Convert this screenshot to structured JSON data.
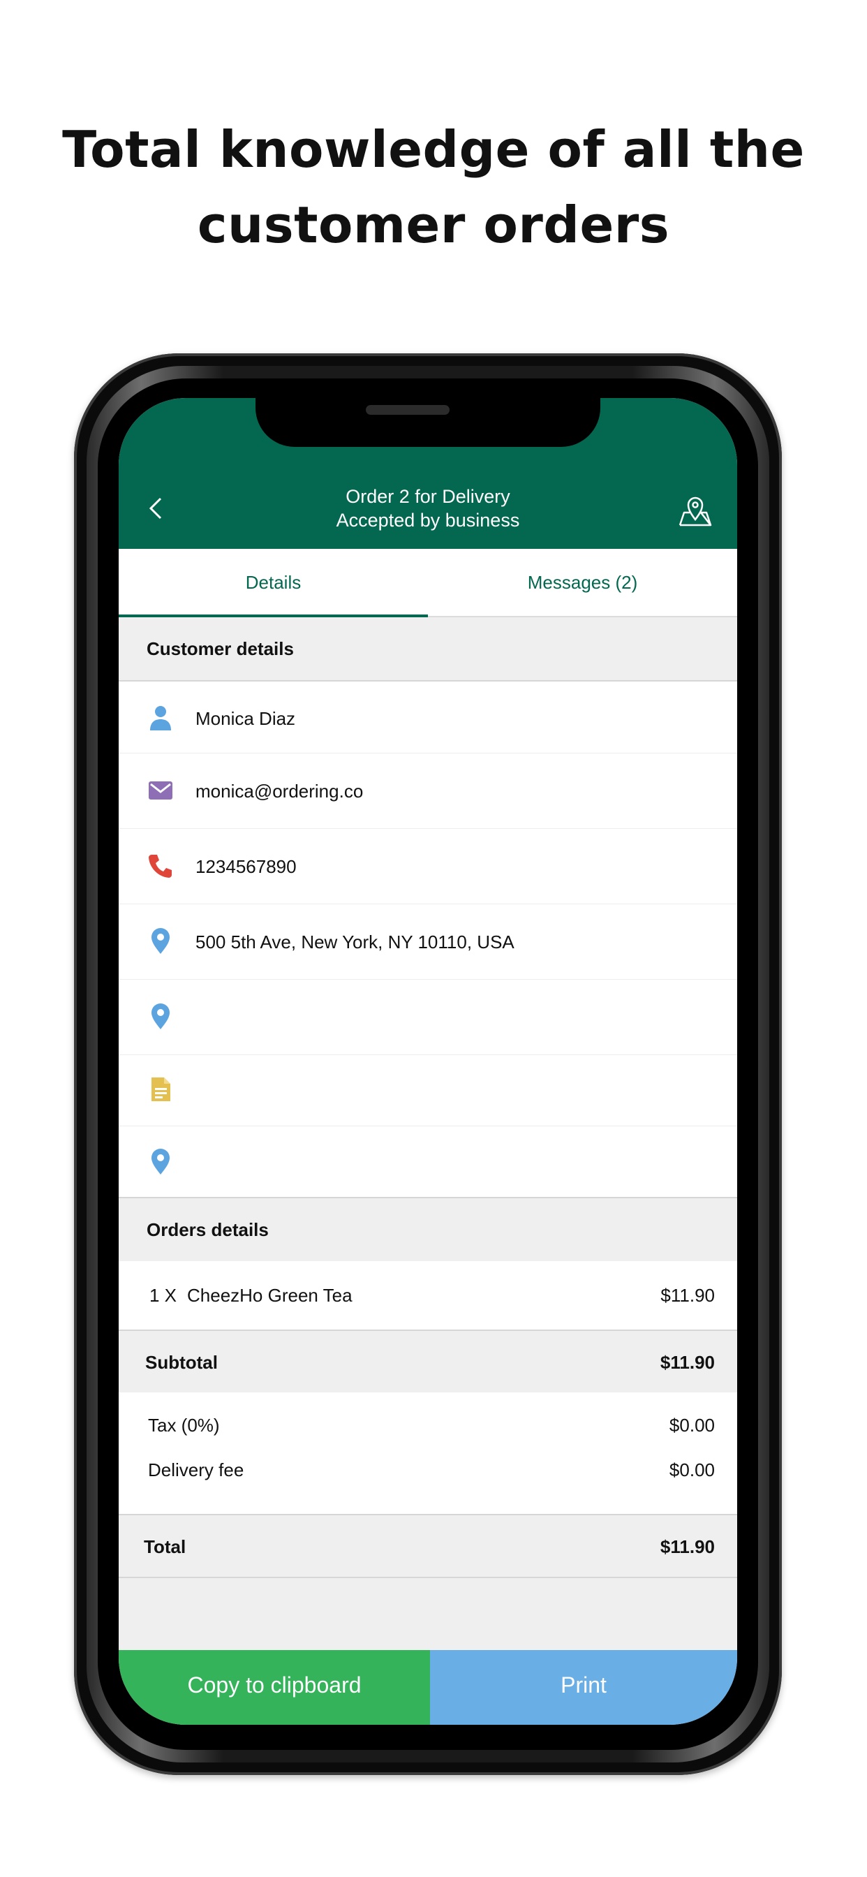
{
  "headline": {
    "line1": "Total knowledge of all the",
    "line2": "customer orders"
  },
  "header": {
    "title": "Order 2 for Delivery",
    "subtitle": "Accepted by business",
    "back_icon": "chevron-left-icon",
    "map_icon": "map-pin-icon"
  },
  "tabs": [
    {
      "label": "Details",
      "active": true
    },
    {
      "label": "Messages (2)",
      "active": false
    }
  ],
  "customer": {
    "section_title": "Customer details",
    "name": "Monica Diaz",
    "email": "monica@ordering.co",
    "phone": "1234567890",
    "address": "500 5th Ave, New York, NY 10110, USA",
    "address_extra": "",
    "notes": "",
    "zipcode": ""
  },
  "orders": {
    "section_title": "Orders details",
    "items": [
      {
        "qty": "1 X",
        "name": "CheezHo Green Tea",
        "price": "$11.90"
      }
    ],
    "subtotal_label": "Subtotal",
    "subtotal": "$11.90",
    "tax_label": "Tax (0%)",
    "tax": "$0.00",
    "delivery_label": "Delivery fee",
    "delivery": "$0.00",
    "total_label": "Total",
    "total": "$11.90"
  },
  "actions": {
    "copy_label": "Copy to clipboard",
    "print_label": "Print"
  },
  "colors": {
    "brand": "#046851",
    "copy": "#34b35b",
    "print": "#6aaee6",
    "person_icon": "#5ba4e0",
    "email_icon": "#8e6fb5",
    "phone_icon": "#e0453a",
    "pin_icon": "#5ba4e0",
    "notes_icon": "#e3c04f"
  }
}
